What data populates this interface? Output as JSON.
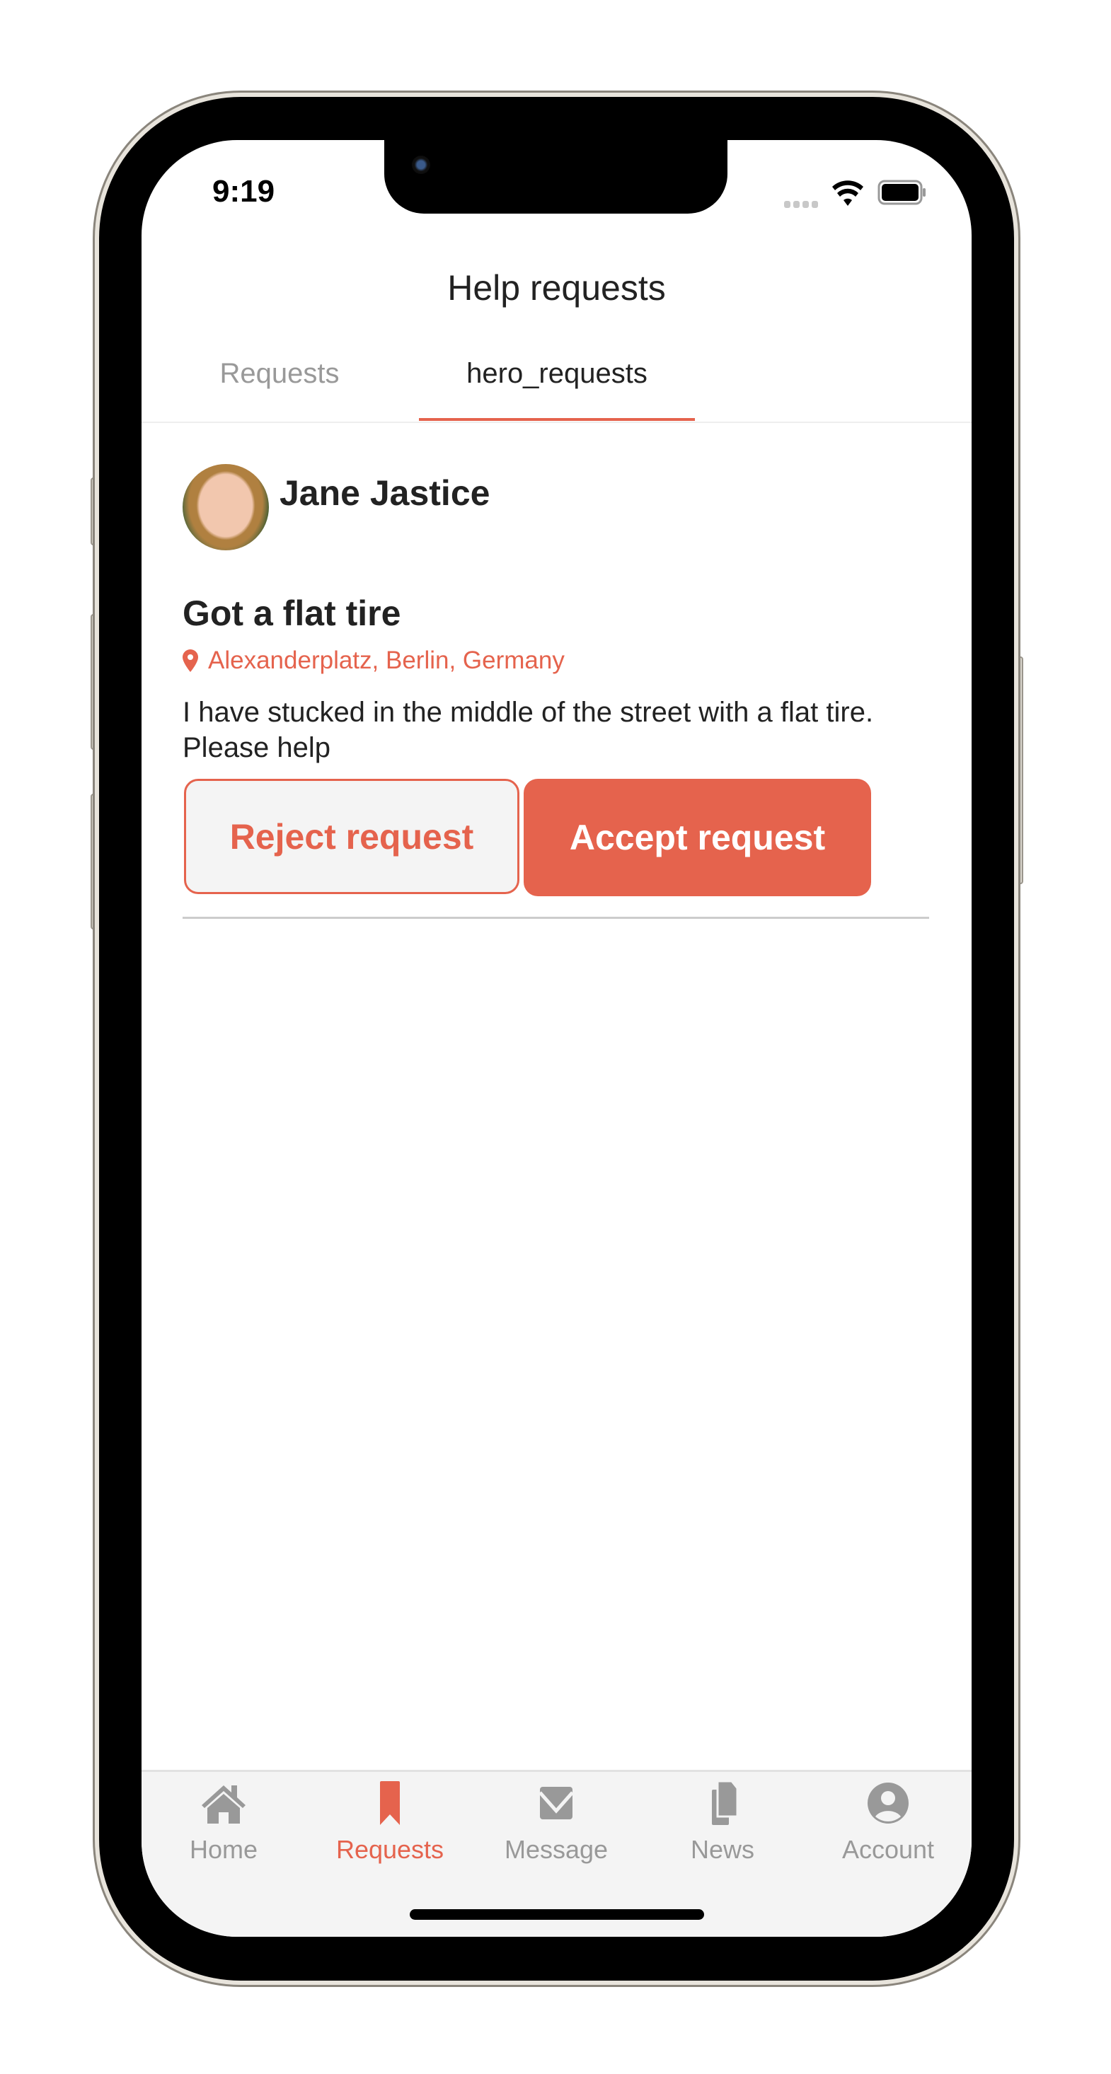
{
  "status_bar": {
    "time": "9:19"
  },
  "header": {
    "title": "Help requests"
  },
  "tabs": [
    {
      "label": "Requests",
      "active": false
    },
    {
      "label": "hero_requests",
      "active": true
    }
  ],
  "request": {
    "user_name": "Jane Jastice",
    "title": "Got a flat tire",
    "location": "Alexanderplatz, Berlin, Germany",
    "description": "I have stucked in the middle of the street with a flat tire. Please help",
    "reject_label": "Reject request",
    "accept_label": "Accept request"
  },
  "bottom_nav": [
    {
      "label": "Home",
      "icon": "home-icon"
    },
    {
      "label": "Requests",
      "icon": "bookmark-icon",
      "active": true
    },
    {
      "label": "Message",
      "icon": "envelope-icon"
    },
    {
      "label": "News",
      "icon": "documents-icon"
    },
    {
      "label": "Account",
      "icon": "user-circle-icon"
    }
  ],
  "colors": {
    "accent": "#e5634d",
    "inactive": "#999999",
    "tabbar_bg": "#f4f4f4"
  }
}
